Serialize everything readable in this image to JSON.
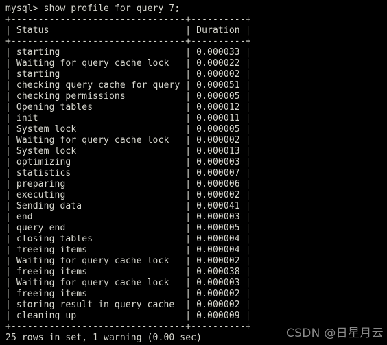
{
  "terminal": {
    "prompt": "mysql> show profile for query 7;",
    "border_top": "+--------------------------------+----------+",
    "border_header": "+--------------------------------+----------+",
    "border_bottom": "+--------------------------------+----------+",
    "footer": "25 rows in set, 1 warning (0.00 sec)",
    "background_color": "#000000",
    "text_color": "#d6d6ce"
  },
  "table": {
    "headers": [
      "Status",
      "Duration"
    ],
    "header_line": "| Status                         | Duration |",
    "status_col_width": 32,
    "duration_col_width": 10,
    "rows": [
      {
        "status": "starting",
        "duration": "0.000033"
      },
      {
        "status": "Waiting for query cache lock",
        "duration": "0.000022"
      },
      {
        "status": "starting",
        "duration": "0.000002"
      },
      {
        "status": "checking query cache for query",
        "duration": "0.000051"
      },
      {
        "status": "checking permissions",
        "duration": "0.000005"
      },
      {
        "status": "Opening tables",
        "duration": "0.000012"
      },
      {
        "status": "init",
        "duration": "0.000011"
      },
      {
        "status": "System lock",
        "duration": "0.000005"
      },
      {
        "status": "Waiting for query cache lock",
        "duration": "0.000002"
      },
      {
        "status": "System lock",
        "duration": "0.000013"
      },
      {
        "status": "optimizing",
        "duration": "0.000003"
      },
      {
        "status": "statistics",
        "duration": "0.000007"
      },
      {
        "status": "preparing",
        "duration": "0.000006"
      },
      {
        "status": "executing",
        "duration": "0.000002"
      },
      {
        "status": "Sending data",
        "duration": "0.000041"
      },
      {
        "status": "end",
        "duration": "0.000003"
      },
      {
        "status": "query end",
        "duration": "0.000005"
      },
      {
        "status": "closing tables",
        "duration": "0.000004"
      },
      {
        "status": "freeing items",
        "duration": "0.000004"
      },
      {
        "status": "Waiting for query cache lock",
        "duration": "0.000002"
      },
      {
        "status": "freeing items",
        "duration": "0.000038"
      },
      {
        "status": "Waiting for query cache lock",
        "duration": "0.000003"
      },
      {
        "status": "freeing items",
        "duration": "0.000002"
      },
      {
        "status": "storing result in query cache",
        "duration": "0.000002"
      },
      {
        "status": "cleaning up",
        "duration": "0.000009"
      }
    ]
  },
  "watermark": {
    "text": "CSDN @日星月云",
    "color": "#8a8a8a"
  }
}
